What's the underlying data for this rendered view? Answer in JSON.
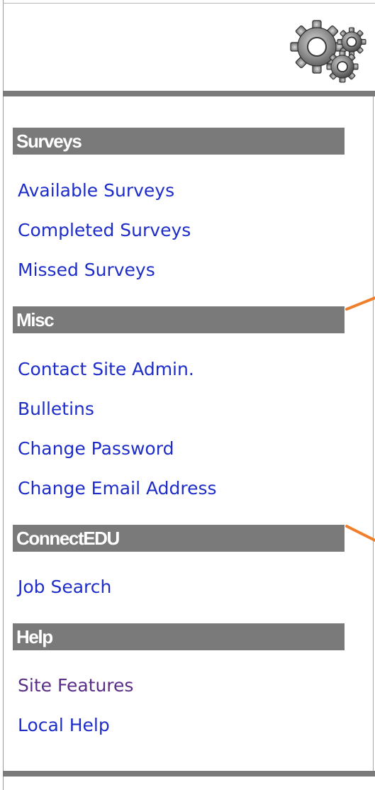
{
  "header": {
    "icon": "gears-icon"
  },
  "sections": [
    {
      "title": "Surveys",
      "links": [
        {
          "label": "Available Surveys"
        },
        {
          "label": "Completed Surveys"
        },
        {
          "label": "Missed Surveys"
        }
      ]
    },
    {
      "title": "Misc",
      "links": [
        {
          "label": "Contact Site Admin."
        },
        {
          "label": "Bulletins"
        },
        {
          "label": "Change Password"
        },
        {
          "label": "Change Email Address"
        }
      ]
    },
    {
      "title": "ConnectEDU",
      "links": [
        {
          "label": "Job Search"
        }
      ]
    },
    {
      "title": "Help",
      "links": [
        {
          "label": "Site Features"
        },
        {
          "label": "Local Help"
        }
      ]
    }
  ],
  "colors": {
    "link": "#1e2dc9",
    "visited_link": "#5a2d86",
    "section_header_bg": "#7a7a7a",
    "rule": "#7b7b7b",
    "annotation_arrow": "#f07f2b"
  }
}
